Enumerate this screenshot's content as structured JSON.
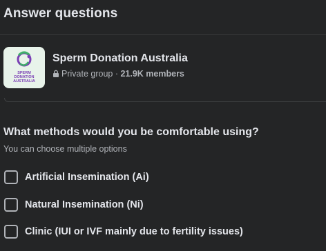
{
  "header": {
    "title": "Answer questions"
  },
  "group": {
    "name": "Sperm Donation Australia",
    "privacy": "Private group",
    "separator": " · ",
    "members": "21.9K members",
    "logo_text_line1": "SPERM",
    "logo_text_line2": "DONATION",
    "logo_text_line3": "AUSTRALIA",
    "logo_icon": "lock-icon"
  },
  "question": {
    "title": "What methods would you be comfortable using?",
    "hint": "You can choose multiple options",
    "options": [
      {
        "label": "Artificial Insemination (Ai)",
        "checked": false
      },
      {
        "label": "Natural Insemination (Ni)",
        "checked": false
      },
      {
        "label": "Clinic (IUI or IVF mainly due to fertility issues)",
        "checked": false
      }
    ]
  },
  "colors": {
    "background": "#242526",
    "text_primary": "#e4e6eb",
    "text_secondary": "#b0b3b8",
    "logo_bg": "#e8f3ea",
    "logo_purple": "#7b3fb5",
    "logo_green": "#3fae6a"
  }
}
